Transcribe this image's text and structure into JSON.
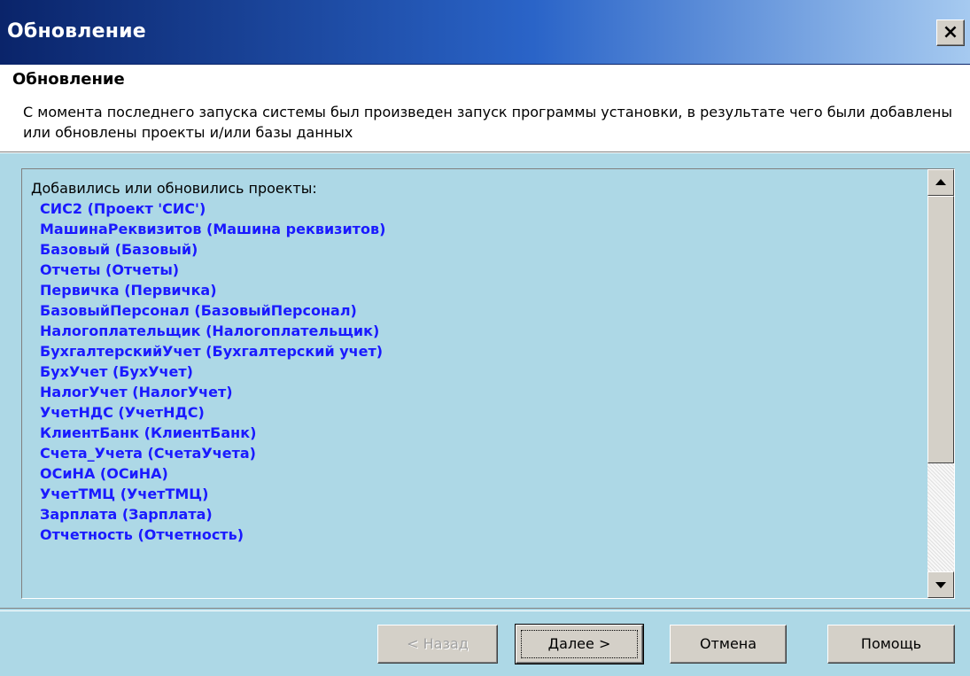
{
  "window": {
    "title": "Обновление",
    "close_label": "×"
  },
  "header": {
    "title": "Обновление",
    "description": "С момента последнего запуска системы был произведен запуск программы установки, в результате чего были добавлены или обновлены проекты и/или базы данных"
  },
  "list": {
    "header": "Добавились или обновились проекты:",
    "items": [
      "СИС2 (Проект 'СИС')",
      "МашинаРеквизитов (Машина реквизитов)",
      "Базовый (Базовый)",
      "Отчеты (Отчеты)",
      "Первичка (Первичка)",
      "БазовыйПерсонал (БазовыйПерсонал)",
      "Налогоплательщик (Налогоплательщик)",
      "БухгалтерскийУчет (Бухгалтерский учет)",
      "БухУчет (БухУчет)",
      "НалогУчет (НалогУчет)",
      "УчетНДС (УчетНДС)",
      "КлиентБанк (КлиентБанк)",
      "Счета_Учета (СчетаУчета)",
      "ОСиНА (ОСиНА)",
      "УчетТМЦ (УчетТМЦ)",
      "Зарплата (Зарплата)",
      "Отчетность (Отчетность)"
    ],
    "scroll_up_icon": "arrow-up-icon",
    "scroll_down_icon": "arrow-down-icon"
  },
  "buttons": {
    "back": "< Назад",
    "next": "Далее >",
    "cancel": "Отмена",
    "help": "Помощь"
  },
  "colors": {
    "title_bar_start": "#0a246a",
    "title_bar_end": "#a6caf0",
    "panel_bg": "#add8e6",
    "list_item_text": "#1a1aff"
  }
}
